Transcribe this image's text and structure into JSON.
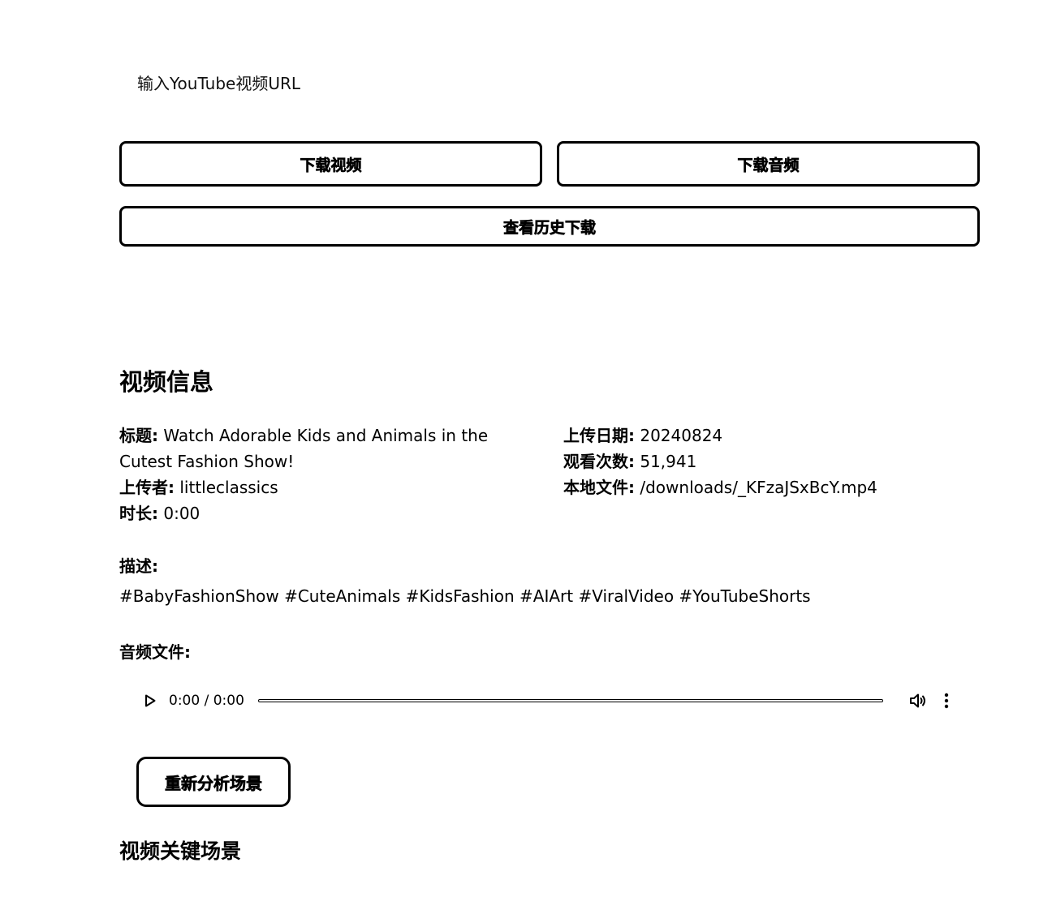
{
  "url_input": {
    "placeholder": "输入YouTube视频URL",
    "value": ""
  },
  "buttons": {
    "download_video": "下载视频",
    "download_audio": "下载音频",
    "view_history": "查看历史下载",
    "reanalyze_scenes": "重新分析场景"
  },
  "video_info": {
    "heading": "视频信息",
    "title_key": "标题:",
    "title_value": "Watch Adorable Kids and Animals in the Cutest Fashion Show!",
    "uploader_key": "上传者:",
    "uploader_value": "littleclassics",
    "duration_key": "时长:",
    "duration_value": "0:00",
    "upload_date_key": "上传日期:",
    "upload_date_value": "20240824",
    "view_count_key": "观看次数:",
    "view_count_value": "51,941",
    "local_file_key": "本地文件:",
    "local_file_value": "/downloads/_KFzaJSxBcY.mp4"
  },
  "description": {
    "label": "描述:",
    "text": "#BabyFashionShow #CuteAnimals #KidsFashion #AIArt #ViralVideo #YouTubeShorts"
  },
  "audio": {
    "label": "音频文件:",
    "time": "0:00 / 0:00",
    "progress": 0,
    "icons": {
      "play": "play-icon",
      "volume": "volume-icon",
      "more": "more-options-icon"
    }
  },
  "scenes": {
    "heading": "视频关键场景"
  }
}
